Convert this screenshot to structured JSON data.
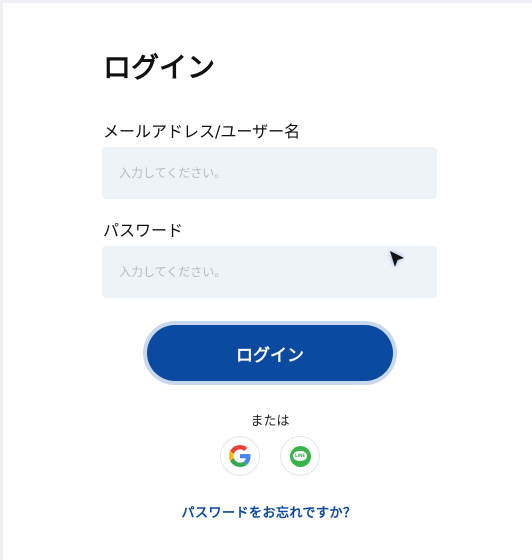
{
  "login_form": {
    "title": "ログイン",
    "email_label": "メールアドレス/ユーザー名",
    "email_placeholder": "入力してください。",
    "email_value": "",
    "password_label": "パスワード",
    "password_placeholder": "入力してください。",
    "password_value": "",
    "submit_label": "ログイン",
    "or_text": "または",
    "social": [
      {
        "name": "google",
        "icon": "google-icon"
      },
      {
        "name": "line",
        "icon": "line-icon",
        "badge_text": "LINE"
      }
    ],
    "forgot_link": "パスワードをお忘れですか？"
  },
  "colors": {
    "primary": "#0a4aa0",
    "input_bg": "#eef3f8",
    "button_ring": "#c9d8ec",
    "line_green": "#37b34a"
  }
}
